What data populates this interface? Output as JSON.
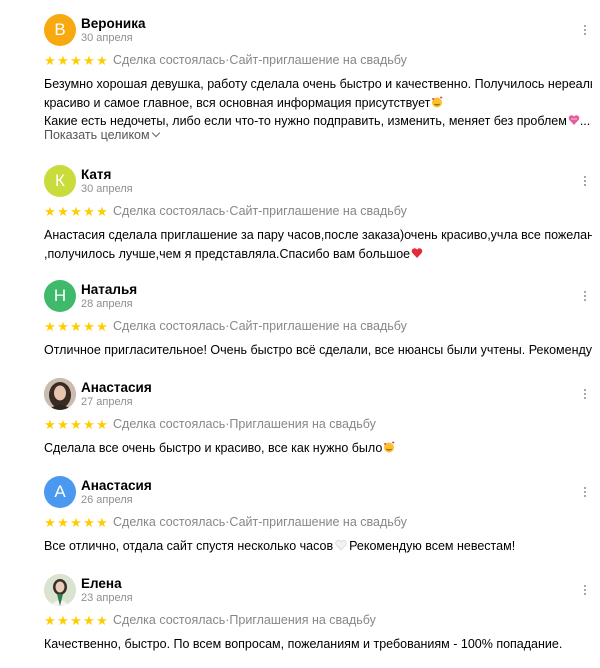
{
  "meta_text": {
    "deal": "Сделка состоялась",
    "separator": " · "
  },
  "show_more_label": "Показать целиком",
  "reviews": [
    {
      "name": "Вероника",
      "initial": "В",
      "avatar_color": "#f7a90f",
      "date": "30 апреля",
      "rating": 5,
      "service": "Сайт-приглашение на свадьбу",
      "lines": [
        "Безумно хорошая девушка, работу сделала очень быстро и качественно. Получилось нереально",
        "красиво и самое главное, вся основная информация присутствует",
        "Какие есть недочеты, либо если что-то нужно подправить, изменить, меняет без проблем"
      ],
      "line3_suffix": "..."
    },
    {
      "name": "Катя",
      "initial": "К",
      "avatar_color": "#c9dc3c",
      "date": "30 апреля",
      "rating": 5,
      "service": "Сайт-приглашение на свадьбу",
      "lines": [
        "Анастасия сделала приглашение за пару часов,после заказа)очень красиво,учла все пожелания",
        ",получилось лучше,чем я представляла.Спасибо вам большое"
      ]
    },
    {
      "name": "Наталья",
      "initial": "Н",
      "avatar_color": "#3fba6b",
      "date": "28 апреля",
      "rating": 5,
      "service": "Сайт-приглашение на свадьбу",
      "lines": [
        "Отличное пригласительное! Очень быстро всё сделали, все нюансы были учтены. Рекомендую!"
      ]
    },
    {
      "name": "Анастасия",
      "date": "27 апреля",
      "rating": 5,
      "service": "Приглашения на свадьбу",
      "lines": [
        "Сделала все очень быстро и красиво, все как нужно было"
      ]
    },
    {
      "name": "Анастасия",
      "initial": "А",
      "avatar_color": "#4a98ef",
      "date": "26 апреля",
      "rating": 5,
      "service": "Сайт-приглашение на свадьбу",
      "lines": [
        "Все отлично, отдала сайт спустя несколько часов",
        "Рекомендую всем невестам!"
      ]
    },
    {
      "name": "Елена",
      "date": "23 апреля",
      "rating": 5,
      "service": "Приглашения на свадьбу",
      "lines": [
        "Качественно, быстро. По всем вопросам, пожеланиям и требованиям - 100% попадание."
      ]
    }
  ]
}
